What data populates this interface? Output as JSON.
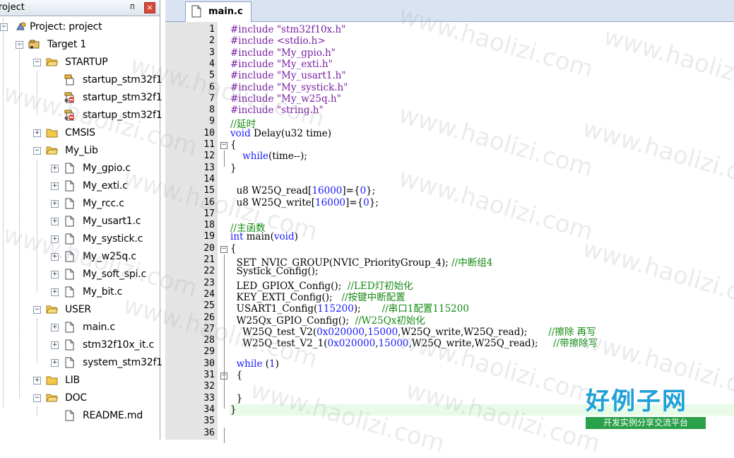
{
  "project_panel": {
    "title": "roject",
    "pin_glyph": "ᴨ",
    "close_glyph": "×",
    "tree": [
      {
        "label": "Project: project",
        "icon": "project-icon",
        "expander": "−"
      },
      {
        "label": "Target 1",
        "icon": "target-icon",
        "expander": "−"
      },
      {
        "label": "STARTUP",
        "icon": "folder-open-icon",
        "expander": "−"
      },
      {
        "label": "startup_stm32f1",
        "icon": "startup-file-icon",
        "expander": ""
      },
      {
        "label": "startup_stm32f1",
        "icon": "startup-file-excluded-icon",
        "expander": ""
      },
      {
        "label": "startup_stm32f1",
        "icon": "startup-file-excluded-icon",
        "expander": ""
      },
      {
        "label": "CMSIS",
        "icon": "folder-closed-icon",
        "expander": "+"
      },
      {
        "label": "My_Lib",
        "icon": "folder-open-icon",
        "expander": "−"
      },
      {
        "label": "My_gpio.c",
        "icon": "file-icon",
        "expander": "+"
      },
      {
        "label": "My_exti.c",
        "icon": "file-icon",
        "expander": "+"
      },
      {
        "label": "My_rcc.c",
        "icon": "file-icon",
        "expander": "+"
      },
      {
        "label": "My_usart1.c",
        "icon": "file-icon",
        "expander": "+"
      },
      {
        "label": "My_systick.c",
        "icon": "file-icon",
        "expander": "+"
      },
      {
        "label": "My_w25q.c",
        "icon": "file-icon",
        "expander": "+"
      },
      {
        "label": "My_soft_spi.c",
        "icon": "file-icon",
        "expander": "+"
      },
      {
        "label": "My_bit.c",
        "icon": "file-icon",
        "expander": "+"
      },
      {
        "label": "USER",
        "icon": "folder-open-icon",
        "expander": "−"
      },
      {
        "label": "main.c",
        "icon": "file-icon",
        "expander": "+"
      },
      {
        "label": "stm32f10x_it.c",
        "icon": "file-icon",
        "expander": "+"
      },
      {
        "label": "system_stm32f1",
        "icon": "file-icon",
        "expander": "+"
      },
      {
        "label": "LIB",
        "icon": "folder-closed-icon",
        "expander": "+"
      },
      {
        "label": "DOC",
        "icon": "folder-open-icon",
        "expander": "−"
      },
      {
        "label": "README.md",
        "icon": "file-icon",
        "expander": ""
      }
    ]
  },
  "editor": {
    "tab_label": "main.c",
    "lines": [
      [
        [
          "pp",
          "#include "
        ],
        [
          "st",
          "\"stm32f10x.h\""
        ]
      ],
      [
        [
          "pp",
          "#include "
        ],
        [
          "st",
          "<stdio.h>"
        ]
      ],
      [
        [
          "pp",
          "#include "
        ],
        [
          "st",
          "\"My_gpio.h\""
        ]
      ],
      [
        [
          "pp",
          "#include "
        ],
        [
          "st",
          "\"My_exti.h\""
        ]
      ],
      [
        [
          "pp",
          "#include "
        ],
        [
          "st",
          "\"My_usart1.h\""
        ]
      ],
      [
        [
          "pp",
          "#include "
        ],
        [
          "st",
          "\"My_systick.h\""
        ]
      ],
      [
        [
          "pp",
          "#include "
        ],
        [
          "st",
          "\"My_w25q.h\""
        ]
      ],
      [
        [
          "pp",
          "#include "
        ],
        [
          "st",
          "\"string.h\""
        ]
      ],
      [
        [
          "cm",
          "//延时"
        ]
      ],
      [
        [
          "kw",
          "void "
        ],
        [
          "id",
          "Delay(u32 time)"
        ]
      ],
      [
        [
          "id",
          "{"
        ]
      ],
      [
        [
          "id",
          "    "
        ],
        [
          "kw",
          "while"
        ],
        [
          "id",
          "(time--);"
        ]
      ],
      [
        [
          "id",
          "}"
        ]
      ],
      [],
      [
        [
          "id",
          "  u8 W25Q_read["
        ],
        [
          "nm",
          "16000"
        ],
        [
          "id",
          "]={"
        ],
        [
          "nm",
          "0"
        ],
        [
          "id",
          "};"
        ]
      ],
      [
        [
          "id",
          "  u8 W25Q_write["
        ],
        [
          "nm",
          "16000"
        ],
        [
          "id",
          "]={"
        ],
        [
          "nm",
          "0"
        ],
        [
          "id",
          "};"
        ]
      ],
      [],
      [
        [
          "cm",
          "//主函数"
        ]
      ],
      [
        [
          "kw",
          "int "
        ],
        [
          "id",
          "main("
        ],
        [
          "kw",
          "void"
        ],
        [
          "id",
          ")"
        ]
      ],
      [
        [
          "id",
          "{"
        ]
      ],
      [
        [
          "id",
          "  SET_NVIC_GROUP(NVIC_PriorityGroup_4); "
        ],
        [
          "cm",
          "//中断组4"
        ]
      ],
      [
        [
          "id",
          "  Systick_Config();"
        ]
      ],
      [
        [
          "id",
          "  LED_GPIOX_Config();  "
        ],
        [
          "cm",
          "//LED灯初始化"
        ]
      ],
      [
        [
          "id",
          "  KEY_EXTI_Config();   "
        ],
        [
          "cm",
          "//按键中断配置"
        ]
      ],
      [
        [
          "id",
          "  USART1_Config("
        ],
        [
          "nm",
          "115200"
        ],
        [
          "id",
          ");       "
        ],
        [
          "cm",
          "//串口1配置115200"
        ]
      ],
      [
        [
          "id",
          "  W25Qx_GPIO_Config();  "
        ],
        [
          "cm",
          "//W25Qx初始化"
        ]
      ],
      [
        [
          "id",
          "    W25Q_test_V2("
        ],
        [
          "nm",
          "0x020000"
        ],
        [
          "id",
          ","
        ],
        [
          "nm",
          "15000"
        ],
        [
          "id",
          ",W25Q_write,W25Q_read);       "
        ],
        [
          "cm",
          "//擦除 再写"
        ]
      ],
      [
        [
          "id",
          "    W25Q_test_V2_1("
        ],
        [
          "nm",
          "0x020000"
        ],
        [
          "id",
          ","
        ],
        [
          "nm",
          "15000"
        ],
        [
          "id",
          ",W25Q_write,W25Q_read);     "
        ],
        [
          "cm",
          "//带擦除写"
        ]
      ],
      [],
      [
        [
          "id",
          "  "
        ],
        [
          "kw",
          "while"
        ],
        [
          "id",
          " ("
        ],
        [
          "nm",
          "1"
        ],
        [
          "id",
          ")"
        ]
      ],
      [
        [
          "id",
          "  {"
        ]
      ],
      [],
      [
        [
          "id",
          "  }"
        ]
      ],
      [
        [
          "id",
          "}"
        ]
      ],
      [],
      []
    ]
  },
  "watermark": {
    "text": "www.haolizi.com",
    "logo_text": "好例子网",
    "logo_subtitle": "开发实例分享交流平台"
  }
}
